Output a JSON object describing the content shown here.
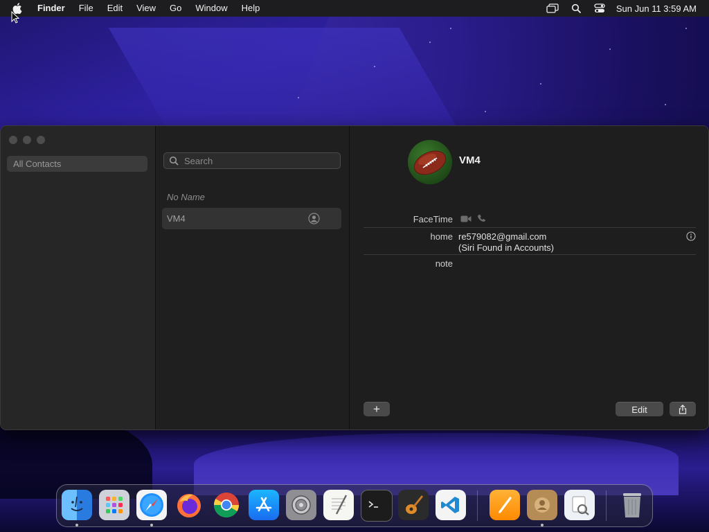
{
  "menubar": {
    "app_name": "Finder",
    "items": [
      "File",
      "Edit",
      "View",
      "Go",
      "Window",
      "Help"
    ],
    "clock": "Sun Jun 11  3:59 AM"
  },
  "sidebar": {
    "selected_item": "All Contacts"
  },
  "list": {
    "search_placeholder": "Search",
    "group_header": "No Name",
    "contacts": [
      {
        "name": "VM4"
      }
    ]
  },
  "detail": {
    "contact_name": "VM4",
    "facetime_label": "FaceTime",
    "email_label": "home",
    "email_value": "re579082@gmail.com",
    "email_source": "(Siri Found in Accounts)",
    "note_label": "note",
    "add_label": "+",
    "edit_label": "Edit"
  },
  "dock": {
    "apps": [
      "Finder",
      "Launchpad",
      "Safari",
      "Firefox",
      "Chrome",
      "App Store",
      "System Preferences",
      "TextEdit",
      "Terminal",
      "GarageBand",
      "Visual Studio Code",
      "Pages",
      "Contacts",
      "Preview",
      "Trash"
    ]
  },
  "colors": {
    "accent_blue": "#2a1c8a",
    "window_bg": "#1e1e1e",
    "menubar_bg": "#1d1d1f"
  }
}
